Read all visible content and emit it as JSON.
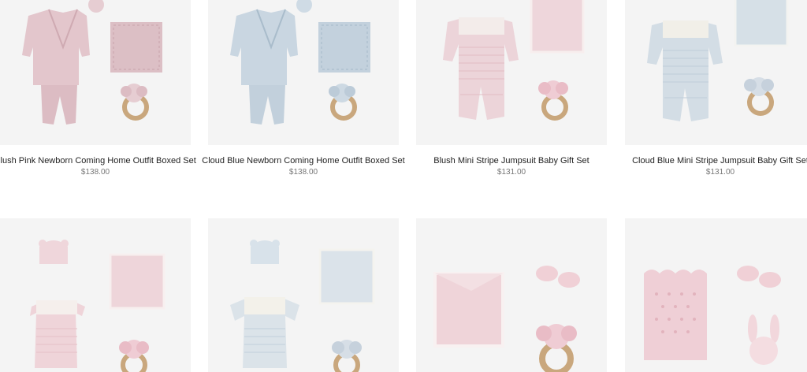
{
  "products": [
    {
      "title": "Blush Pink Newborn Coming Home Outfit Boxed Set",
      "price": "$138.00",
      "accent": "#e8cdd2",
      "illustration": "knit-outfit-set"
    },
    {
      "title": "Cloud Blue Newborn Coming Home Outfit Boxed Set",
      "price": "$138.00",
      "accent": "#c8d6e2",
      "illustration": "knit-outfit-set"
    },
    {
      "title": "Blush Mini Stripe Jumpsuit Baby Gift Set",
      "price": "$131.00",
      "accent": "#eccfd6",
      "illustration": "jumpsuit-gift-set"
    },
    {
      "title": "Cloud Blue Mini Stripe Jumpsuit Baby Gift Set",
      "price": "$131.00",
      "accent": "#cdd8e0",
      "illustration": "jumpsuit-gift-set"
    },
    {
      "title": "",
      "price": "",
      "accent": "#eccfd6",
      "illustration": "bubble-romper-set"
    },
    {
      "title": "",
      "price": "",
      "accent": "#cdd8e0",
      "illustration": "shortall-set"
    },
    {
      "title": "",
      "price": "",
      "accent": "#efd3d8",
      "illustration": "blanket-booties-elephant-set"
    },
    {
      "title": "",
      "price": "",
      "accent": "#efd3d8",
      "illustration": "pointelle-blanket-bunny-set"
    }
  ]
}
